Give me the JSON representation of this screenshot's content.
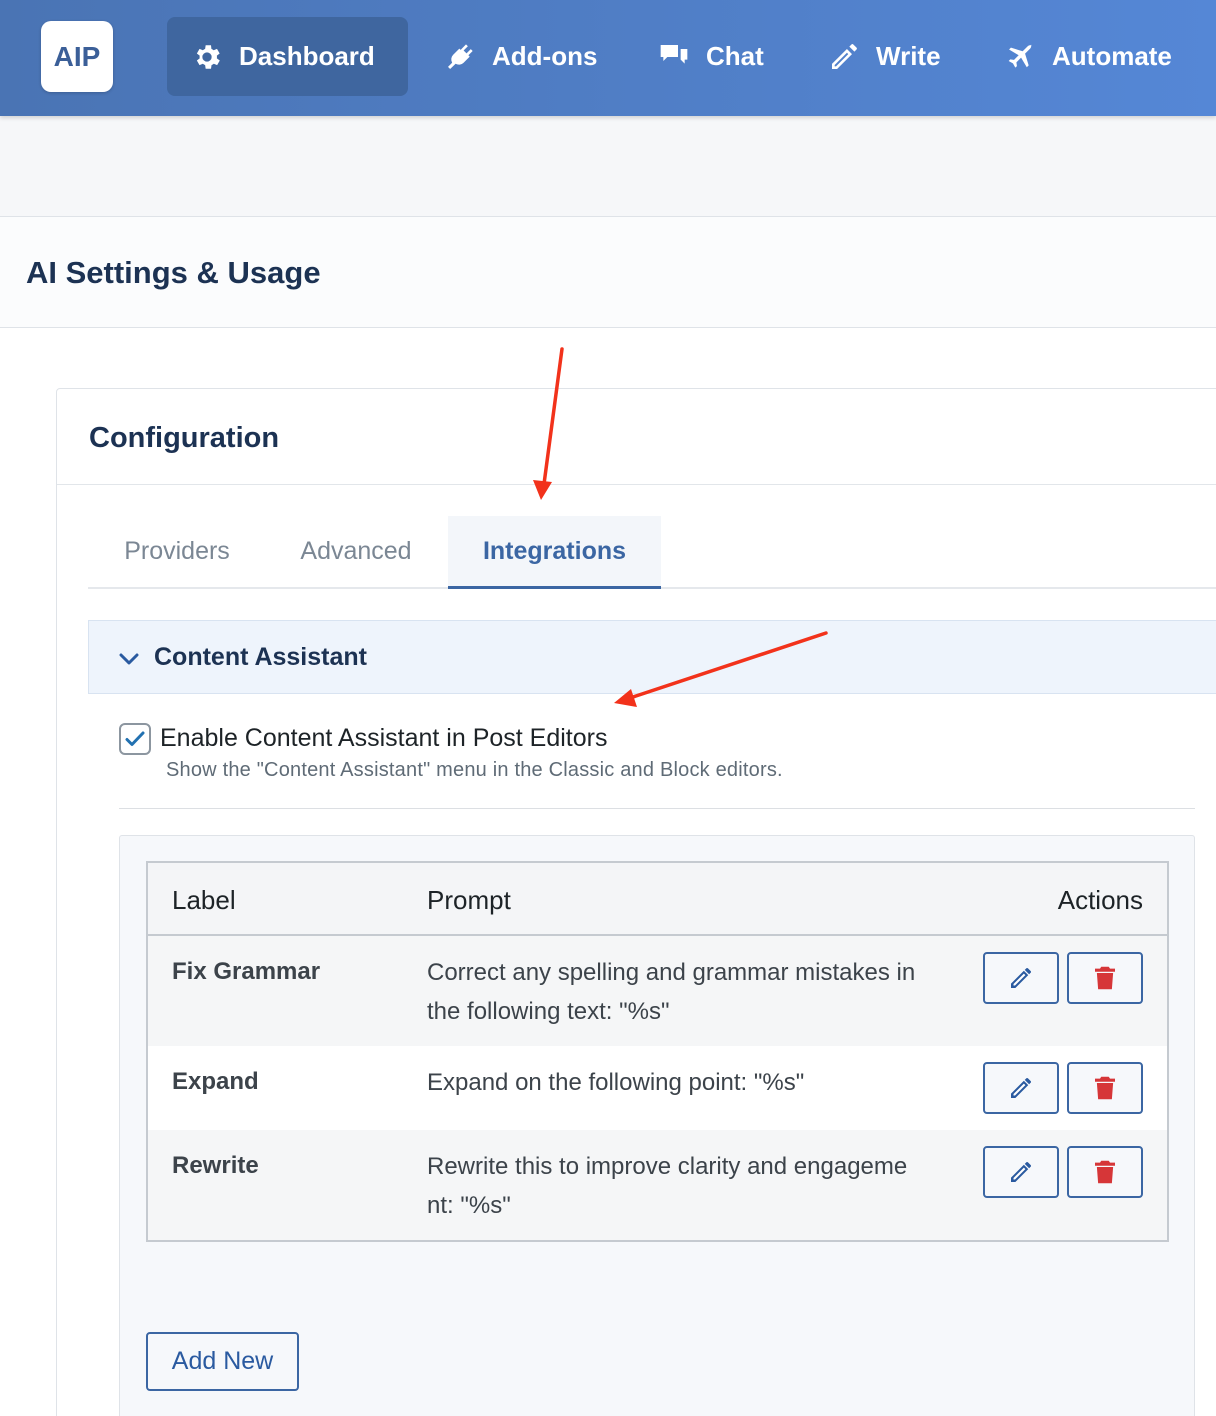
{
  "nav": {
    "logo": "AIP",
    "items": [
      {
        "label": "Dashboard",
        "icon": "gear-icon",
        "active": true
      },
      {
        "label": "Add-ons",
        "icon": "plug-icon",
        "active": false
      },
      {
        "label": "Chat",
        "icon": "chat-bubbles-icon",
        "active": false
      },
      {
        "label": "Write",
        "icon": "pencil-icon",
        "active": false
      },
      {
        "label": "Automate",
        "icon": "plane-icon",
        "active": false
      }
    ]
  },
  "page": {
    "title": "AI Settings & Usage"
  },
  "config": {
    "title": "Configuration",
    "tabs": [
      {
        "label": "Providers",
        "active": false
      },
      {
        "label": "Advanced",
        "active": false
      },
      {
        "label": "Integrations",
        "active": true
      }
    ]
  },
  "content_assistant": {
    "title": "Content Assistant",
    "expanded": true,
    "enable_label": "Enable Content Assistant in Post Editors",
    "enable_checked": true,
    "enable_description": "Show the \"Content Assistant\" menu in the Classic and Block editors.",
    "table": {
      "headers": {
        "label": "Label",
        "prompt": "Prompt",
        "actions": "Actions"
      },
      "rows": [
        {
          "label": "Fix Grammar",
          "prompt": "Correct any spelling and grammar mistakes in the following text: \"%s\""
        },
        {
          "label": "Expand",
          "prompt": "Expand on the following point: \"%s\""
        },
        {
          "label": "Rewrite",
          "prompt": "Rewrite this to improve clarity and engagement: \"%s\""
        }
      ]
    },
    "add_new_label": "Add New"
  },
  "colors": {
    "nav_bg": "#4a74b4",
    "accent": "#3b66a3",
    "delete": "#d63638",
    "annotation": "#f2321b"
  }
}
